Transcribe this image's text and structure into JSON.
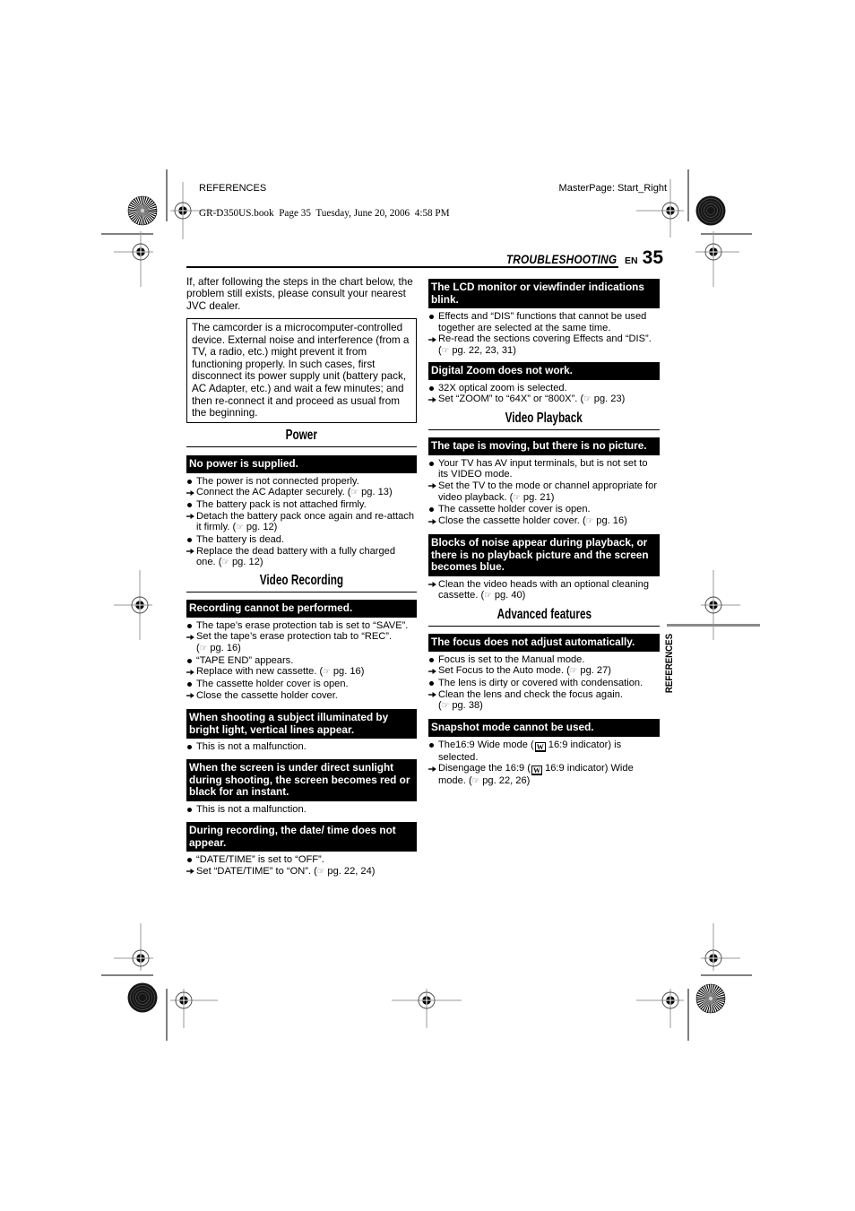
{
  "header": {
    "section_label": "REFERENCES",
    "master_page": "MasterPage: Start_Right",
    "book_info": "GR-D350US.book  Page 35  Tuesday, June 20, 2006  4:58 PM",
    "chapter_title": "TROUBLESHOOTING",
    "language": "EN",
    "page_number": "35"
  },
  "intro": "If, after following the steps in the chart below, the problem still exists, please consult your nearest JVC dealer.",
  "notice": "The camcorder is a microcomputer-controlled\ndevice. External noise and interference (from a\nTV, a radio, etc.) might prevent it from\nfunctioning properly. In such cases, first\ndisconnect its power supply unit (battery pack,\nAC Adapter, etc.) and wait a few minutes; and\nthen re-connect it and proceed as usual from\nthe beginning.",
  "side_tab": "REFERENCES",
  "icons": {
    "cause_marker": "bullet",
    "remedy_marker": "arrow",
    "page_reference": "pointing-hand"
  },
  "sections": {
    "power": {
      "title": "Power",
      "problems": [
        {
          "title": "No power is supplied.",
          "items": [
            {
              "type": "cause",
              "text": "The power is not connected properly."
            },
            {
              "type": "remedy",
              "text": "Connect the AC Adapter securely.",
              "ref": "pg. 13"
            },
            {
              "type": "cause",
              "text": "The battery pack is not attached firmly."
            },
            {
              "type": "remedy",
              "text": "Detach the battery pack once again and re-attach\nit firmly.",
              "ref": "pg. 12"
            },
            {
              "type": "cause",
              "text": "The battery is dead."
            },
            {
              "type": "remedy",
              "text": "Replace the dead battery with a fully charged\none.",
              "ref": "pg. 12"
            }
          ]
        }
      ]
    },
    "video_recording": {
      "title": "Video Recording",
      "problems": [
        {
          "title": "Recording cannot be performed.",
          "items": [
            {
              "type": "cause",
              "text": "The tape’s erase protection tab is set to “SAVE”."
            },
            {
              "type": "remedy",
              "text": "Set the tape’s erase protection tab to “REC”.\n",
              "ref": "pg. 16"
            },
            {
              "type": "cause",
              "text": "“TAPE END” appears."
            },
            {
              "type": "remedy",
              "text": "Replace with new cassette.",
              "ref": "pg. 16"
            },
            {
              "type": "cause",
              "text": "The cassette holder cover is open."
            },
            {
              "type": "remedy",
              "text": "Close the cassette holder cover."
            }
          ]
        },
        {
          "title": "When shooting a subject illuminated by\nbright light, vertical lines appear.",
          "items": [
            {
              "type": "cause",
              "text": "This is not a malfunction."
            }
          ]
        },
        {
          "title": "When the screen is under direct sunlight\nduring shooting, the screen becomes red or\nblack for an instant.",
          "items": [
            {
              "type": "cause",
              "text": "This is not a malfunction."
            }
          ]
        },
        {
          "title": "During recording, the date/ time does not\nappear.",
          "items": [
            {
              "type": "cause",
              "text": "“DATE/TIME” is set to “OFF”."
            },
            {
              "type": "remedy",
              "text": "Set “DATE/TIME” to “ON”.",
              "ref": "pg. 22, 24"
            }
          ]
        },
        {
          "title": "The LCD monitor or viewfinder indications\nblink.",
          "items": [
            {
              "type": "cause",
              "text": "Effects and “DIS” functions that cannot be used\ntogether are selected at the same time."
            },
            {
              "type": "remedy",
              "text": "Re-read the sections covering Effects and “DIS”.\n",
              "ref": "pg. 22, 23, 31"
            }
          ]
        },
        {
          "title": "Digital Zoom does not work.",
          "items": [
            {
              "type": "cause",
              "text": "32X optical zoom is selected."
            },
            {
              "type": "remedy",
              "text": "Set “ZOOM” to “64X” or “800X”.",
              "ref": "pg. 23"
            }
          ]
        }
      ]
    },
    "video_playback": {
      "title": "Video Playback",
      "problems": [
        {
          "title": "The tape is moving, but there is no picture.",
          "items": [
            {
              "type": "cause",
              "text": "Your TV has AV input terminals, but is not set to\nits VIDEO mode."
            },
            {
              "type": "remedy",
              "text": "Set the TV to the mode or channel appropriate for\nvideo playback.",
              "ref": "pg. 21"
            },
            {
              "type": "cause",
              "text": "The cassette holder cover is open."
            },
            {
              "type": "remedy",
              "text": "Close the cassette holder cover.",
              "ref": "pg. 16"
            }
          ]
        },
        {
          "title": "Blocks of noise appear during playback, or\nthere is no playback picture and the screen\nbecomes blue.",
          "items": [
            {
              "type": "remedy",
              "text": "Clean the video heads with an optional cleaning\ncassette.",
              "ref": "pg. 40"
            }
          ]
        }
      ]
    },
    "advanced_features": {
      "title": "Advanced features",
      "problems": [
        {
          "title": "The focus does not adjust automatically.",
          "items": [
            {
              "type": "cause",
              "text": "Focus is set to the Manual mode."
            },
            {
              "type": "remedy",
              "text": "Set Focus to the Auto mode.",
              "ref": "pg. 27"
            },
            {
              "type": "cause",
              "text": "The lens is dirty or covered with condensation."
            },
            {
              "type": "remedy",
              "text": "Clean the lens and check the focus again.\n",
              "ref": "pg. 38"
            }
          ]
        },
        {
          "title": "Snapshot mode cannot be used.",
          "items": [
            {
              "type": "cause",
              "text_before": "The16:9 Wide mode (",
              "indicator": "W",
              "text_after": " 16:9 indicator) is\nselected."
            },
            {
              "type": "remedy",
              "text_before": "Disengage the 16:9 (",
              "indicator": "W",
              "text_after": " 16:9 indicator) Wide\nmode.",
              "ref": "pg. 22, 26"
            }
          ]
        }
      ]
    }
  }
}
